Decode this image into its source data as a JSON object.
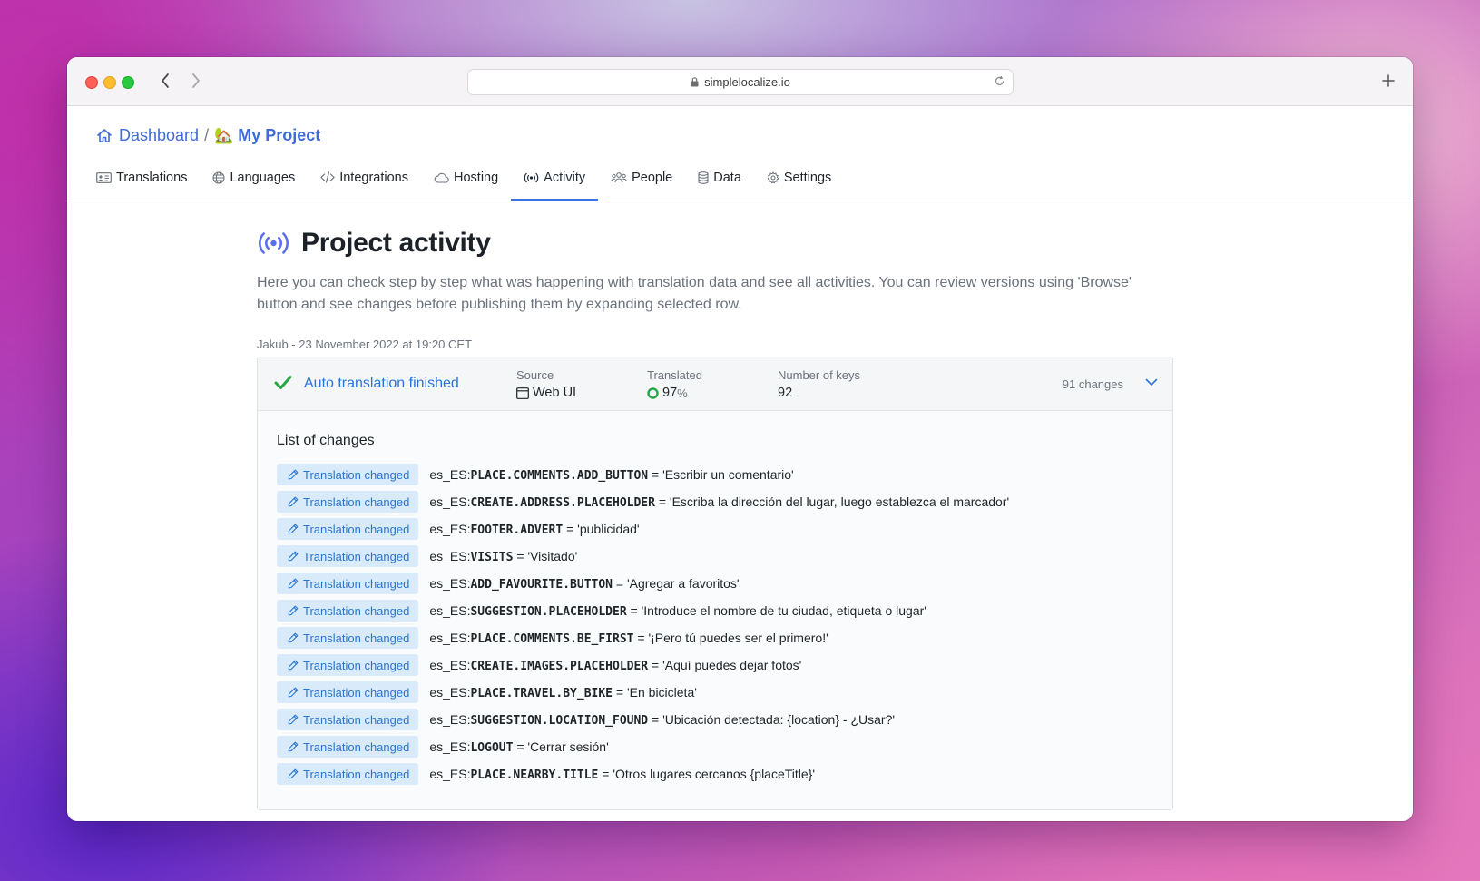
{
  "browser": {
    "url": "simplelocalize.io"
  },
  "breadcrumb": {
    "home": "Dashboard",
    "separator": "/",
    "project_emoji": "🏡",
    "project": "My Project"
  },
  "tabs": [
    {
      "label": "Translations",
      "icon": "id-card-icon"
    },
    {
      "label": "Languages",
      "icon": "globe-icon"
    },
    {
      "label": "Integrations",
      "icon": "code-icon"
    },
    {
      "label": "Hosting",
      "icon": "cloud-icon"
    },
    {
      "label": "Activity",
      "icon": "broadcast-icon",
      "active": true
    },
    {
      "label": "People",
      "icon": "people-icon"
    },
    {
      "label": "Data",
      "icon": "database-icon"
    },
    {
      "label": "Settings",
      "icon": "gear-icon"
    }
  ],
  "page": {
    "title": "Project activity",
    "description": "Here you can check step by step what was happening with translation data and see all activities. You can review versions using 'Browse' button and see changes before publishing them by expanding selected row."
  },
  "activity": {
    "meta": "Jakub - 23 November 2022 at 19:20 CET",
    "status": "Auto translation finished",
    "source_label": "Source",
    "source_value": "Web UI",
    "translated_label": "Translated",
    "translated_value": "97",
    "translated_unit": "%",
    "keys_label": "Number of keys",
    "keys_value": "92",
    "changes_count": "91 changes",
    "list_title": "List of changes",
    "badge_label": "Translation changed",
    "changes": [
      {
        "lang": "es_ES:",
        "key": "PLACE.COMMENTS.ADD_BUTTON",
        "value": " = 'Escribir un comentario'"
      },
      {
        "lang": "es_ES:",
        "key": "CREATE.ADDRESS.PLACEHOLDER",
        "value": " = 'Escriba la dirección del lugar, luego establezca el marcador'"
      },
      {
        "lang": "es_ES:",
        "key": "FOOTER.ADVERT",
        "value": " = 'publicidad'"
      },
      {
        "lang": "es_ES:",
        "key": "VISITS",
        "value": " = 'Visitado'"
      },
      {
        "lang": "es_ES:",
        "key": "ADD_FAVOURITE.BUTTON",
        "value": " = 'Agregar a favoritos'"
      },
      {
        "lang": "es_ES:",
        "key": "SUGGESTION.PLACEHOLDER",
        "value": " = 'Introduce el nombre de tu ciudad, etiqueta o lugar'"
      },
      {
        "lang": "es_ES:",
        "key": "PLACE.COMMENTS.BE_FIRST",
        "value": " = '¡Pero tú puedes ser el primero!'"
      },
      {
        "lang": "es_ES:",
        "key": "CREATE.IMAGES.PLACEHOLDER",
        "value": " = 'Aquí puedes dejar fotos'"
      },
      {
        "lang": "es_ES:",
        "key": "PLACE.TRAVEL.BY_BIKE",
        "value": " = 'En bicicleta'"
      },
      {
        "lang": "es_ES:",
        "key": "SUGGESTION.LOCATION_FOUND",
        "value": " = 'Ubicación detectada: {location} - ¿Usar?'"
      },
      {
        "lang": "es_ES:",
        "key": "LOGOUT",
        "value": " = 'Cerrar sesión'"
      },
      {
        "lang": "es_ES:",
        "key": "PLACE.NEARBY.TITLE",
        "value": " = 'Otros lugares cercanos {placeTitle}'"
      }
    ]
  },
  "colors": {
    "accent": "#3f6bd8",
    "link_blue": "#2b74d8",
    "success_green": "#28a745",
    "badge_bg": "#d9eafb"
  }
}
